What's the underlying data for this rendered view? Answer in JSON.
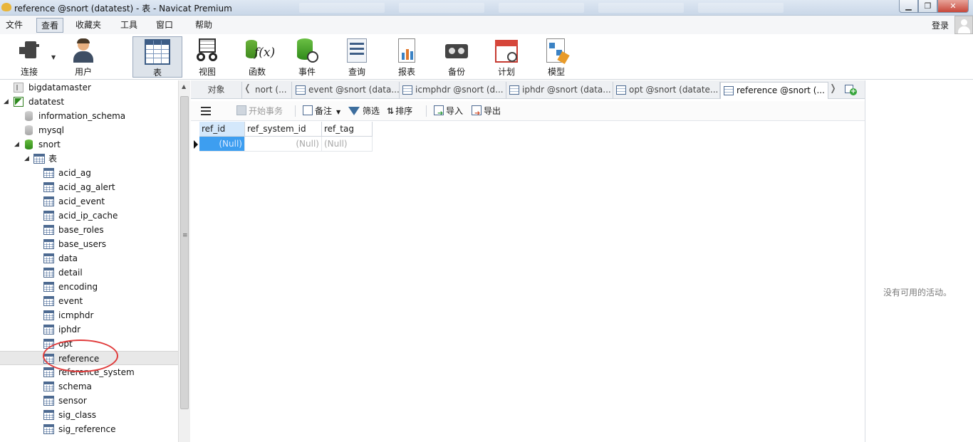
{
  "window": {
    "title": "reference @snort (datatest) - 表 - Navicat Premium"
  },
  "menubar": {
    "items": [
      "文件",
      "查看",
      "收藏夹",
      "工具",
      "窗口",
      "帮助"
    ],
    "active_index": 1,
    "login": "登录"
  },
  "toolbar": {
    "buttons": [
      {
        "label": "连接",
        "icon": "plug-icon"
      },
      {
        "label": "用户",
        "icon": "user-icon"
      },
      {
        "label": "表",
        "icon": "table-icon",
        "active": true
      },
      {
        "label": "视图",
        "icon": "view-icon"
      },
      {
        "label": "函数",
        "icon": "function-icon"
      },
      {
        "label": "事件",
        "icon": "event-icon"
      },
      {
        "label": "查询",
        "icon": "query-icon"
      },
      {
        "label": "报表",
        "icon": "report-icon"
      },
      {
        "label": "备份",
        "icon": "backup-icon"
      },
      {
        "label": "计划",
        "icon": "schedule-icon"
      },
      {
        "label": "模型",
        "icon": "model-icon"
      }
    ]
  },
  "sidebar": {
    "connections": [
      {
        "label": "bigdatamaster"
      },
      {
        "label": "datatest"
      }
    ],
    "databases": [
      {
        "label": "information_schema"
      },
      {
        "label": "mysql"
      },
      {
        "label": "snort"
      }
    ],
    "tables_folder": "表",
    "tables": [
      "acid_ag",
      "acid_ag_alert",
      "acid_event",
      "acid_ip_cache",
      "base_roles",
      "base_users",
      "data",
      "detail",
      "encoding",
      "event",
      "icmphdr",
      "iphdr",
      "opt",
      "reference",
      "reference_system",
      "schema",
      "sensor",
      "sig_class",
      "sig_reference"
    ],
    "selected_table": "reference"
  },
  "tabs": {
    "objects_label": "对象",
    "items": [
      "nort (...",
      "event @snort (data...",
      "icmphdr @snort (d...",
      "iphdr @snort (data...",
      "opt @snort (datate...",
      "reference @snort (..."
    ],
    "active_index": 5
  },
  "data_toolbar": {
    "begin_transaction": "开始事务",
    "memo": "备注",
    "filter": "筛选",
    "sort": "排序",
    "import": "导入",
    "export": "导出"
  },
  "grid": {
    "columns": [
      "ref_id",
      "ref_system_id",
      "ref_tag"
    ],
    "rows": [
      [
        "(Null)",
        "(Null)",
        "(Null)"
      ]
    ]
  },
  "right_panel": {
    "message": "没有可用的活动。"
  },
  "colors": {
    "selected_cell": "#3d9ef0",
    "annotation_circle": "#e03a3a",
    "header_selected": "#d4e8fb"
  }
}
